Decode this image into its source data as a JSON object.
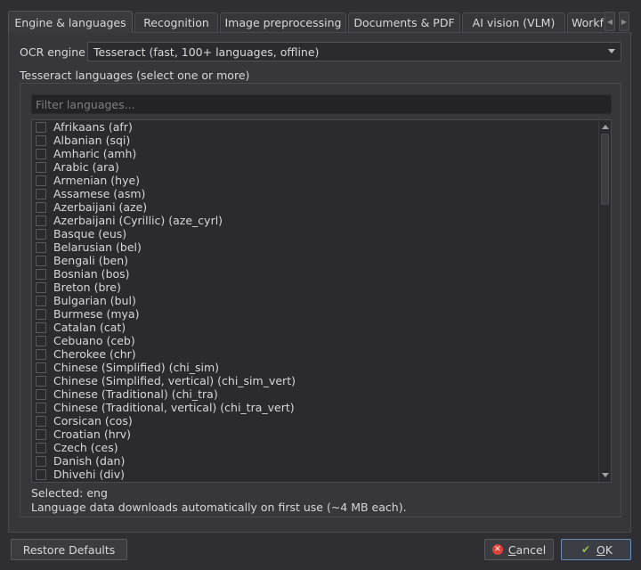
{
  "tabs": [
    {
      "label": "Engine & languages",
      "active": true
    },
    {
      "label": "Recognition"
    },
    {
      "label": "Image preprocessing"
    },
    {
      "label": "Documents & PDF"
    },
    {
      "label": "AI vision (VLM)"
    },
    {
      "label": "Workf"
    }
  ],
  "engine": {
    "label": "OCR engine",
    "value": "Tesseract (fast, 100+ languages, offline)"
  },
  "languages": {
    "group_label": "Tesseract languages (select one or more)",
    "filter_placeholder": "Filter languages...",
    "items": [
      {
        "label": "Afrikaans  (afr)",
        "checked": false
      },
      {
        "label": "Albanian  (sqi)",
        "checked": false
      },
      {
        "label": "Amharic  (amh)",
        "checked": false
      },
      {
        "label": "Arabic  (ara)",
        "checked": false
      },
      {
        "label": "Armenian  (hye)",
        "checked": false
      },
      {
        "label": "Assamese  (asm)",
        "checked": false
      },
      {
        "label": "Azerbaijani  (aze)",
        "checked": false
      },
      {
        "label": "Azerbaijani (Cyrillic)  (aze_cyrl)",
        "checked": false
      },
      {
        "label": "Basque  (eus)",
        "checked": false
      },
      {
        "label": "Belarusian  (bel)",
        "checked": false
      },
      {
        "label": "Bengali  (ben)",
        "checked": false
      },
      {
        "label": "Bosnian  (bos)",
        "checked": false
      },
      {
        "label": "Breton  (bre)",
        "checked": false
      },
      {
        "label": "Bulgarian  (bul)",
        "checked": false
      },
      {
        "label": "Burmese  (mya)",
        "checked": false
      },
      {
        "label": "Catalan  (cat)",
        "checked": false
      },
      {
        "label": "Cebuano  (ceb)",
        "checked": false
      },
      {
        "label": "Cherokee  (chr)",
        "checked": false
      },
      {
        "label": "Chinese (Simplified)  (chi_sim)",
        "checked": false
      },
      {
        "label": "Chinese (Simplified, vertical)  (chi_sim_vert)",
        "checked": false
      },
      {
        "label": "Chinese (Traditional)  (chi_tra)",
        "checked": false
      },
      {
        "label": "Chinese (Traditional, vertical)  (chi_tra_vert)",
        "checked": false
      },
      {
        "label": "Corsican  (cos)",
        "checked": false
      },
      {
        "label": "Croatian  (hrv)",
        "checked": false
      },
      {
        "label": "Czech  (ces)",
        "checked": false
      },
      {
        "label": "Danish  (dan)",
        "checked": false
      },
      {
        "label": "Dhivehi  (div)",
        "checked": false
      }
    ],
    "selected_text": "Selected: eng",
    "note": "Language data downloads automatically on first use (~4 MB each)."
  },
  "buttons": {
    "restore_defaults": "Restore Defaults",
    "cancel_prefix": "",
    "cancel_mnemonic": "C",
    "cancel_rest": "ancel",
    "ok_mnemonic": "O",
    "ok_rest": "K"
  },
  "icons": {
    "cancel": "cancel-circle-icon",
    "ok": "checkmark-icon"
  },
  "colors": {
    "background": "#2f2f33",
    "panel": "#36363b",
    "accent_border": "#6a8fb8",
    "cancel_red": "#e0403a",
    "ok_green": "#9bbf4b"
  }
}
